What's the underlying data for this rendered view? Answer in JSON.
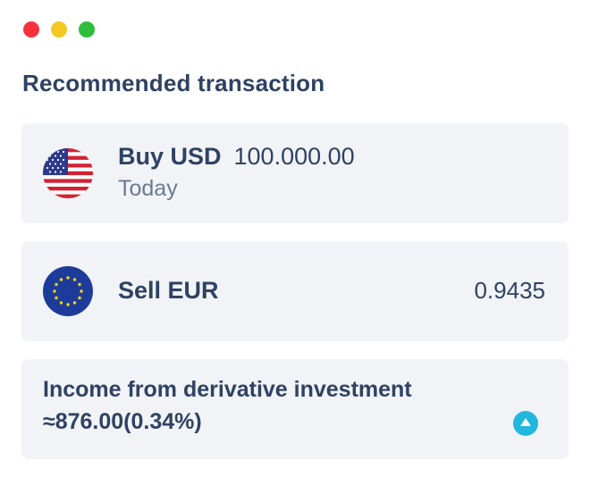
{
  "window": {
    "controls": [
      "close",
      "minimize",
      "maximize"
    ]
  },
  "section_title": "Recommended transaction",
  "buy": {
    "flag_icon": "us-flag-icon",
    "action": "Buy USD",
    "amount": "100.000.00",
    "date": "Today"
  },
  "sell": {
    "flag_icon": "eu-flag-icon",
    "action": "Sell EUR",
    "rate": "0.9435"
  },
  "income": {
    "label": "Income from derivative investment",
    "value": "≈876.00(0.34%)",
    "trend_icon": "arrow-up-circle-icon",
    "trend_color": "#22b7dd"
  },
  "colors": {
    "text": "#2f4263",
    "muted": "#6b7a90",
    "card_bg": "#f1f3f6",
    "close": "#f5323c",
    "minimize": "#f5c824",
    "maximize": "#2ebd3c"
  }
}
